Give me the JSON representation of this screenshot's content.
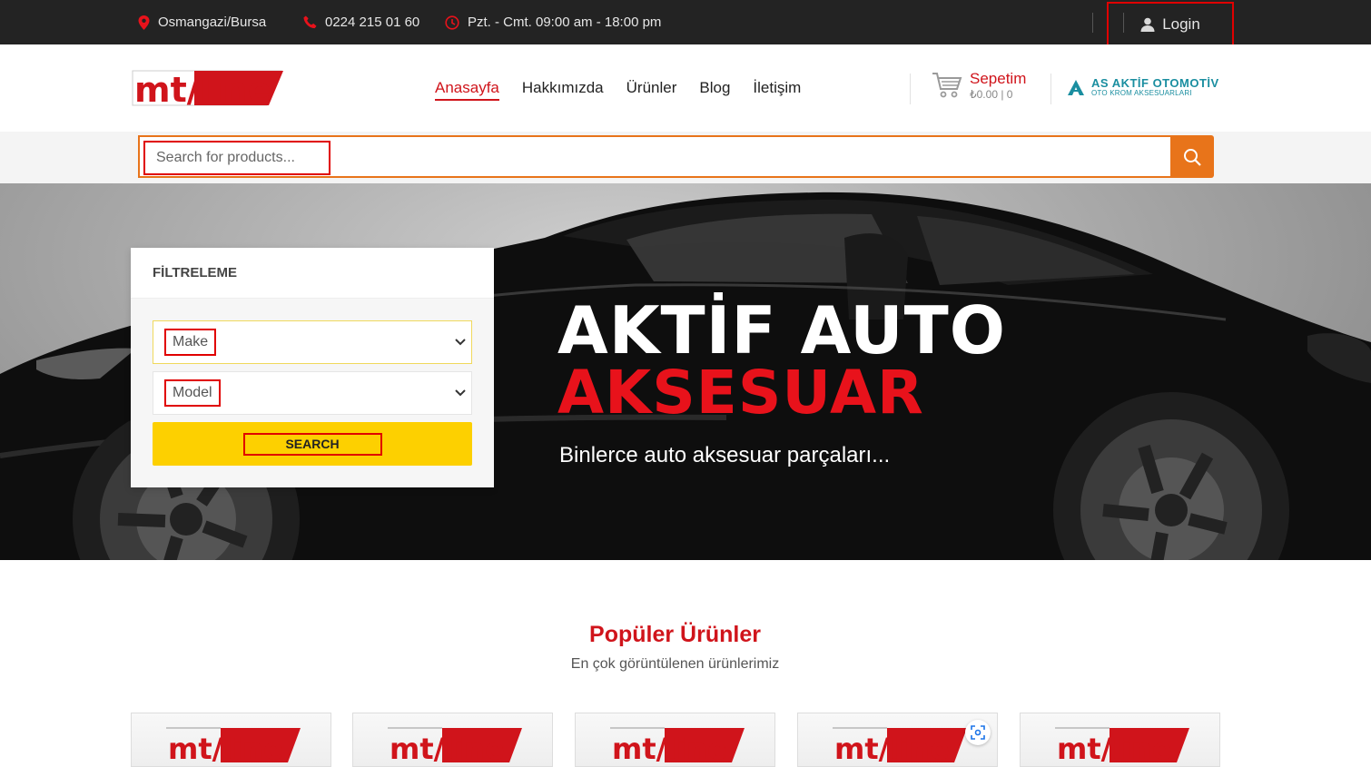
{
  "topbar": {
    "location": "Osmangazi/Bursa",
    "phone": "0224 215 01 60",
    "hours": "Pzt. - Cmt. 09:00 am - 18:00 pm",
    "login_label": "Login"
  },
  "header": {
    "logo_text": "mt/line",
    "nav": [
      "Anasayfa",
      "Hakkımızda",
      "Ürünler",
      "Blog",
      "İletişim"
    ],
    "cart_title": "Sepetim",
    "cart_summary": "₺0.00 | 0",
    "brand_name": "AS AKTİF OTOMOTİV",
    "brand_sub": "OTO KROM AKSESUARLARI"
  },
  "search": {
    "placeholder": "Search for products..."
  },
  "filter": {
    "title": "FİLTRELEME",
    "make_label": "Make",
    "model_label": "Model",
    "button_label": "SEARCH"
  },
  "hero": {
    "title_line1": "AKTİF AUTO",
    "title_line2": "AKSESUAR",
    "subtitle": "Binlerce auto aksesuar parçaları..."
  },
  "popular": {
    "title": "Popüler Ürünler",
    "subtitle": "En çok görüntülenen ürünlerimiz",
    "cards": [
      "mt/line",
      "mt/line",
      "mt/line",
      "mt/line",
      "mt/line"
    ]
  },
  "colors": {
    "accent_red": "#d0141b",
    "search_orange": "#e8741a",
    "button_yellow": "#fdd000",
    "topbar_bg": "#232323",
    "brand_teal": "#1a8ea0"
  }
}
